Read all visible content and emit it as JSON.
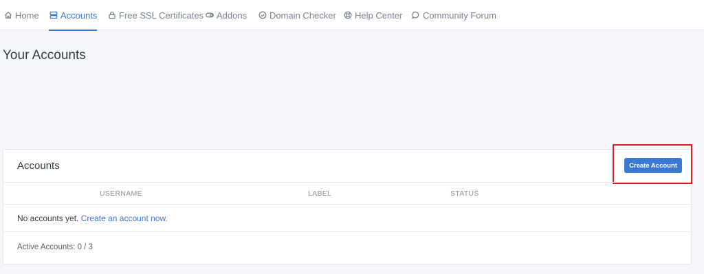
{
  "nav": {
    "items": [
      {
        "label": "Home",
        "icon": "home-icon",
        "active": false
      },
      {
        "label": "Accounts",
        "icon": "server-icon",
        "active": true
      },
      {
        "label": "Free SSL Certificates",
        "icon": "lock-icon",
        "active": false
      },
      {
        "label": "Addons",
        "icon": "toggle-icon",
        "active": false
      },
      {
        "label": "Domain Checker",
        "icon": "check-circle-icon",
        "active": false
      },
      {
        "label": "Help Center",
        "icon": "lifebuoy-icon",
        "active": false
      },
      {
        "label": "Community Forum",
        "icon": "chat-bubble-icon",
        "active": false
      }
    ]
  },
  "page": {
    "title": "Your Accounts"
  },
  "accounts_card": {
    "title": "Accounts",
    "create_button_label": "Create Account",
    "columns": [
      "USERNAME",
      "LABEL",
      "STATUS"
    ],
    "empty_text": "No accounts yet.",
    "empty_link": "Create an account now.",
    "active_accounts_text": "Active Accounts: 0 / 3"
  },
  "colors": {
    "accent": "#3b78d1",
    "highlight": "#e01b1b",
    "background": "#f5f6fa"
  }
}
